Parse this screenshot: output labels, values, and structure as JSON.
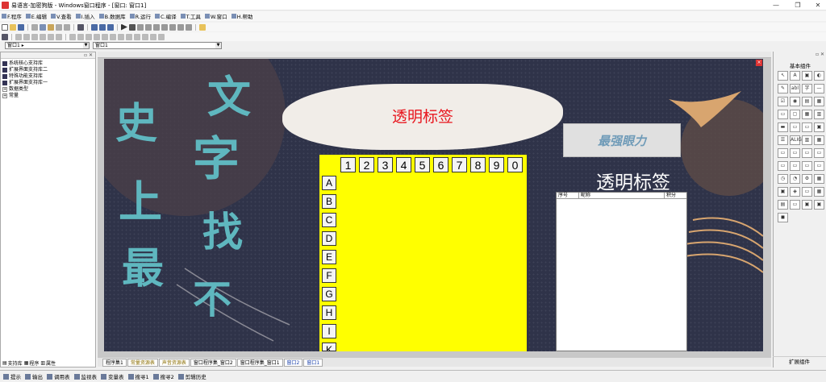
{
  "window": {
    "title": "易语言-加密狗版 - Windows窗口程序 - [窗口: 窗口1]",
    "controls": [
      "—",
      "❐",
      "✕"
    ]
  },
  "menu": [
    {
      "label": "F.程序",
      "icon": "file-icon"
    },
    {
      "label": "E.编辑",
      "icon": "edit-icon"
    },
    {
      "label": "V.查看",
      "icon": "view-icon"
    },
    {
      "label": "I.插入",
      "icon": "insert-icon"
    },
    {
      "label": "B.数据库",
      "icon": "database-icon"
    },
    {
      "label": "R.运行",
      "icon": "run-icon"
    },
    {
      "label": "C.编译",
      "icon": "compile-icon"
    },
    {
      "label": "T.工具",
      "icon": "tools-icon"
    },
    {
      "label": "W.窗口",
      "icon": "window-icon"
    },
    {
      "label": "H.帮助",
      "icon": "help-icon"
    }
  ],
  "combos": {
    "left": "窗口1 ▸",
    "right": "窗口1"
  },
  "left_panel": {
    "tree": [
      {
        "label": "系统核心支持库",
        "type": "lib"
      },
      {
        "label": "扩展界面支持库二",
        "type": "lib"
      },
      {
        "label": "特殊功能支持库",
        "type": "lib"
      },
      {
        "label": "扩展界面支持库一",
        "type": "lib"
      },
      {
        "label": "数据类型",
        "type": "node"
      },
      {
        "label": "常量",
        "type": "node"
      }
    ],
    "tabs": [
      "支持库",
      "程序",
      "属性"
    ]
  },
  "design": {
    "brush_label": "透明标签",
    "image_text": "最强眼力",
    "white_label": "透明标签",
    "calligraphy": [
      "文",
      "字",
      "找",
      "不",
      "史",
      "上",
      "最"
    ],
    "numbers": [
      "1",
      "2",
      "3",
      "4",
      "5",
      "6",
      "7",
      "8",
      "9",
      "0"
    ],
    "letters": [
      "A",
      "B",
      "C",
      "D",
      "E",
      "F",
      "G",
      "H",
      "I",
      "K"
    ],
    "table_headers": [
      "序号",
      "昵称",
      "积分"
    ]
  },
  "right_panel": {
    "title": "基本组件",
    "footer": "扩展组件",
    "icons": [
      "↖",
      "A",
      "▣",
      "◐",
      "✎",
      "abl",
      "字",
      "—",
      "☑",
      "◉",
      "▤",
      "▦",
      "▭",
      "▢",
      "▦",
      "▥",
      "▬",
      "▭",
      "▭",
      "▣",
      "☰",
      "ALIGN",
      "▥",
      "▦",
      "▭",
      "▭",
      "▭",
      "▭",
      "▭",
      "▭",
      "▭",
      "▭",
      "◷",
      "◔",
      "⚙",
      "▦",
      "▣",
      "◈",
      "▭",
      "▦",
      "▤",
      "▭",
      "▣",
      "▣",
      "◼"
    ]
  },
  "bottom_tabs": [
    "程序集1",
    "常量资源表",
    "声音资源表",
    "窗口程序集_窗口2",
    "窗口程序集_窗口1",
    "窗口2",
    "窗口1"
  ],
  "status": [
    {
      "label": "提示",
      "icon": "hint-icon"
    },
    {
      "label": "输出",
      "icon": "output-icon"
    },
    {
      "label": "调用表",
      "icon": "call-table-icon"
    },
    {
      "label": "监视表",
      "icon": "watch-icon"
    },
    {
      "label": "变量表",
      "icon": "variable-icon"
    },
    {
      "label": "搜寻1",
      "icon": "search-icon"
    },
    {
      "label": "搜寻2",
      "icon": "search-icon"
    },
    {
      "label": "剪辑历史",
      "icon": "clip-icon"
    }
  ]
}
